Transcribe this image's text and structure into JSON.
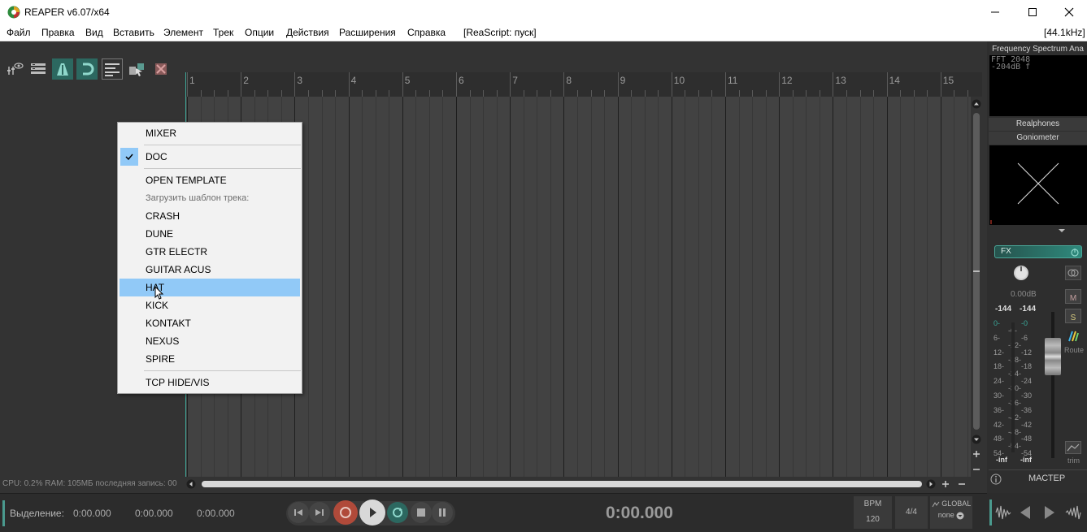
{
  "window": {
    "title": "REAPER v6.07/x64"
  },
  "menu": {
    "items": [
      "Файл",
      "Правка",
      "Вид",
      "Вставить",
      "Элемент",
      "Трек",
      "Опции",
      "Действия",
      "Расширения",
      "Справка",
      "[ReaScript: пуск]"
    ],
    "samplerate": "[44.1kHz]"
  },
  "ruler": {
    "bars": [
      "1",
      "2",
      "3",
      "4",
      "5",
      "6",
      "7",
      "8",
      "9",
      "10",
      "11",
      "12",
      "13",
      "14",
      "15"
    ]
  },
  "status": {
    "cpu": "CPU: 0.2% RAM: 105МБ последняя запись: 00"
  },
  "context_menu": {
    "items": [
      {
        "label": "MIXER"
      },
      {
        "label": "DOC",
        "checked": true
      },
      {
        "label": "OPEN TEMPLATE"
      },
      {
        "label": "Загрузить шаблон трека:",
        "disabled": true
      },
      {
        "label": "CRASH"
      },
      {
        "label": "DUNE"
      },
      {
        "label": "GTR ELECTR"
      },
      {
        "label": "GUITAR ACUS"
      },
      {
        "label": "HAT",
        "highlighted": true
      },
      {
        "label": "KICK"
      },
      {
        "label": "KONTAKT"
      },
      {
        "label": "NEXUS"
      },
      {
        "label": "SPIRE"
      },
      {
        "label": "TCP HIDE/VIS"
      }
    ]
  },
  "master": {
    "fx_spectrum": "Frequency Spectrum Ana",
    "fft_line1": "FFT 2048",
    "fft_line2": "-204dB f",
    "fx_realphones": "Realphones",
    "fx_goniometer": "Goniometer",
    "fx_button": "FX",
    "volume": "0.00dB",
    "peak_left": "-144",
    "peak_right": "-144",
    "mute": "M",
    "solo": "S",
    "route": "Route",
    "trim": "trim",
    "inf_left": "-inf",
    "inf_right": "-inf",
    "name": "МАСТЕР",
    "scale_left": [
      "0-",
      "6-",
      "12-",
      "18-",
      "24-",
      "30-",
      "36-",
      "42-",
      "48-",
      "54-"
    ],
    "scale_mid": [
      "-6-",
      "-12-",
      "-18-",
      "-24-",
      "-30-",
      "-36-",
      "-42-",
      "-48-",
      "-54-"
    ],
    "scale_right": [
      "-0",
      "-6",
      "-12",
      "-18",
      "-24",
      "-30",
      "-36",
      "-42",
      "-48",
      "-54"
    ]
  },
  "transport": {
    "selection_label": "Выделение:",
    "sel_start": "0:00.000",
    "sel_end": "0:00.000",
    "sel_len": "0:00.000",
    "time": "0:00.000",
    "bpm_label": "BPM",
    "bpm_value": "120",
    "timesig": "4/4",
    "global_label": "GLOBAL",
    "global_value": "none"
  }
}
